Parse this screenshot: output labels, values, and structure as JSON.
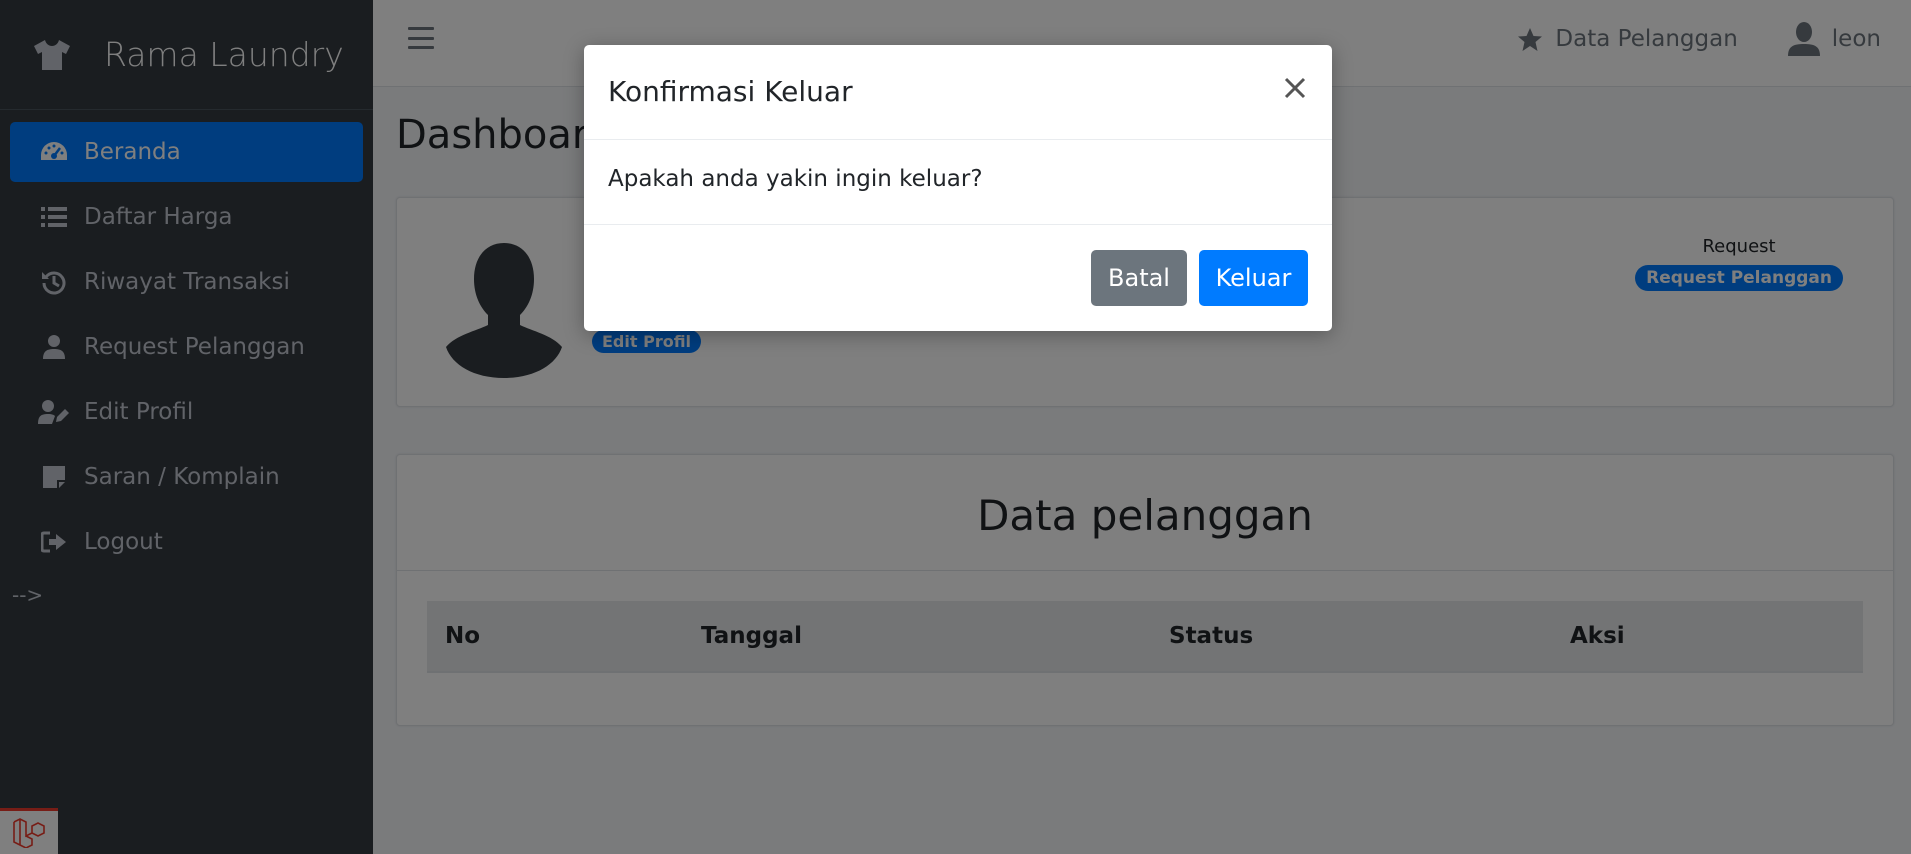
{
  "sidebar": {
    "brand": "Rama Laundry",
    "items": [
      {
        "label": "Beranda",
        "icon": "tachometer-icon",
        "active": true
      },
      {
        "label": "Daftar Harga",
        "icon": "list-icon"
      },
      {
        "label": "Riwayat Transaksi",
        "icon": "history-icon"
      },
      {
        "label": "Request Pelanggan",
        "icon": "user-icon"
      },
      {
        "label": "Edit Profil",
        "icon": "user-edit-icon"
      },
      {
        "label": "Saran / Komplain",
        "icon": "sticky-note-icon"
      },
      {
        "label": "Logout",
        "icon": "sign-out-icon"
      }
    ],
    "stray_text": "-->"
  },
  "topbar": {
    "data_pelanggan": "Data Pelanggan",
    "user": "leon"
  },
  "main": {
    "title": "Dashboard",
    "profile": {
      "edit_badge": "Edit Profil",
      "request_label": "Request",
      "request_badge": "Request Pelanggan"
    },
    "data_card": {
      "title": "Data pelanggan",
      "columns": [
        "No",
        "Tanggal",
        "Status",
        "Aksi"
      ]
    }
  },
  "modal": {
    "title": "Konfirmasi Keluar",
    "body": "Apakah anda yakin ingin keluar?",
    "cancel": "Batal",
    "confirm": "Keluar"
  },
  "colors": {
    "primary": "#007bff",
    "sidebar": "#343a40",
    "secondary": "#6c757d"
  }
}
